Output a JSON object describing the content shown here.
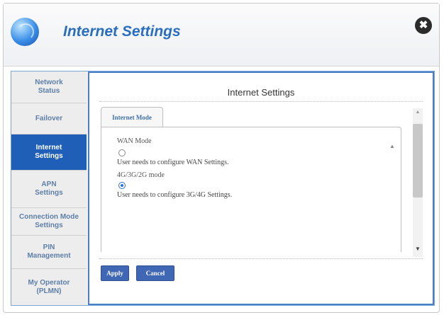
{
  "window": {
    "title": "Internet Settings",
    "close_glyph": "✖",
    "accent_color": "#2a6fbf"
  },
  "sidebar": {
    "items": [
      {
        "label": "Network\nStatus",
        "active": false
      },
      {
        "label": "Failover",
        "active": false
      },
      {
        "label": "Internet\nSettings",
        "active": true
      },
      {
        "label": "APN\nSettings",
        "active": false
      },
      {
        "label": "Connection Mode\nSettings",
        "active": false
      },
      {
        "label": "PIN\nManagement",
        "active": false
      },
      {
        "label": "My Operator\n(PLMN)",
        "active": false
      }
    ]
  },
  "panel": {
    "title": "Internet Settings",
    "tab_label": "Internet Mode",
    "options": [
      {
        "label": "WAN Mode",
        "description": "User needs to configure WAN Settings.",
        "selected": false
      },
      {
        "label": "4G/3G/2G mode",
        "description": "User needs to configure 3G/4G Settings.",
        "selected": true
      }
    ],
    "apply_label": "Apply",
    "cancel_label": "Cancel"
  },
  "icons": {
    "app": "globe-icon",
    "close": "close-icon",
    "scroll_up": "arrow-up-icon",
    "scroll_down": "arrow-down-icon"
  }
}
